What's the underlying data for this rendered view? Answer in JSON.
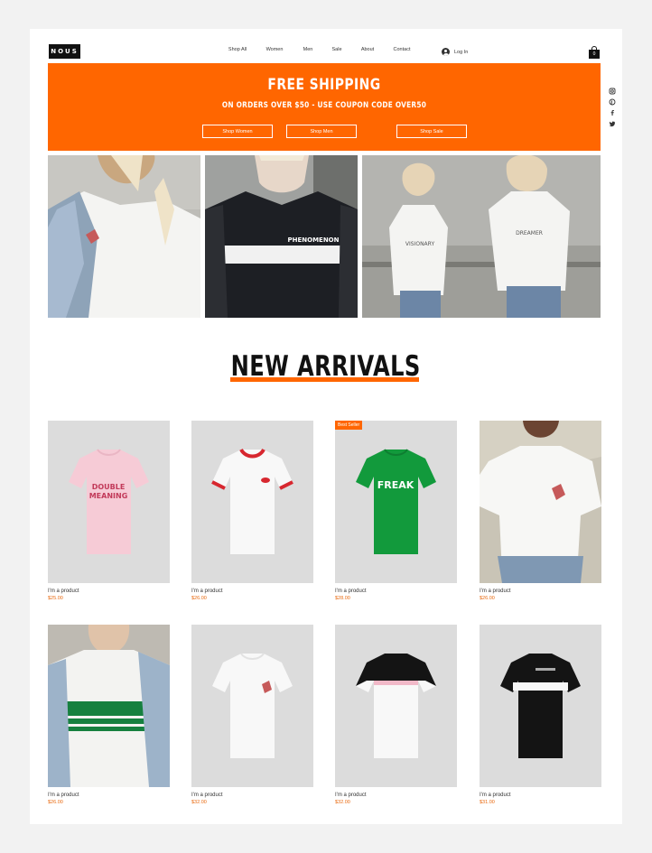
{
  "header": {
    "logo": "NOUS",
    "nav": [
      "Shop All",
      "Women",
      "Men",
      "Sale",
      "About",
      "Contact"
    ],
    "login_label": "Log In",
    "cart_count": "0"
  },
  "social": [
    "instagram-icon",
    "pinterest-icon",
    "facebook-icon",
    "twitter-icon"
  ],
  "banner": {
    "title": "FREE SHIPPING",
    "subtitle": "ON ORDERS OVER $50 - USE COUPON CODE OVER50",
    "buttons": [
      "Shop Women",
      "Shop Men",
      "Shop Sale"
    ],
    "color": "#ff6600"
  },
  "hero_shirts": {
    "middle": "PHENOMENON",
    "right_left": "VISIONARY",
    "right_right": "DREAMER"
  },
  "arrivals": {
    "title": "NEW ARRIVALS"
  },
  "products": [
    {
      "name": "I'm a product",
      "price": "$25.00",
      "shirt_text": [
        "DOUBLE",
        "MEANING"
      ]
    },
    {
      "name": "I'm a product",
      "price": "$26.00"
    },
    {
      "name": "I'm a product",
      "price": "$28.00",
      "badge": "Best Seller",
      "shirt_text": [
        "FREAK"
      ]
    },
    {
      "name": "I'm a product",
      "price": "$26.00"
    },
    {
      "name": "I'm a product",
      "price": "$26.00"
    },
    {
      "name": "I'm a product",
      "price": "$32.00"
    },
    {
      "name": "I'm a product",
      "price": "$32.00"
    },
    {
      "name": "I'm a product",
      "price": "$31.00"
    }
  ]
}
